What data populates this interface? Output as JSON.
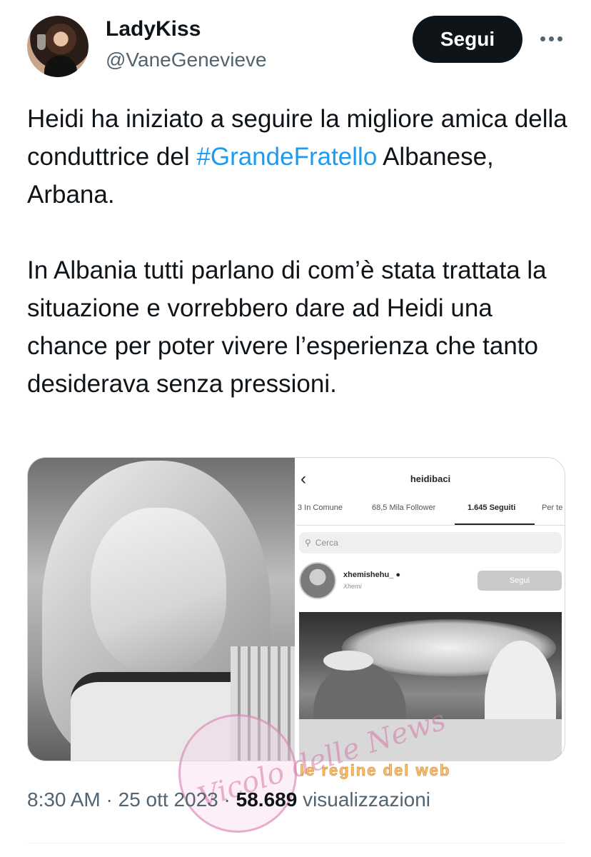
{
  "author": {
    "display_name": "LadyKiss",
    "handle": "@VaneGenevieve"
  },
  "actions": {
    "follow_label": "Segui"
  },
  "tweet": {
    "paragraph1_before": "Heidi ha iniziato a seguire la migliore amica della conduttrice del ",
    "hashtag": "#GrandeFratello",
    "paragraph1_after": " Albanese, Arbana.",
    "paragraph2": "In Albania tutti parlano di com’è stata trattata la situazione e vorrebbero dare ad Heidi una chance per poter vivere l’esperienza che tanto desiderava senza pressioni."
  },
  "embedded_instagram": {
    "username": "heidibaci",
    "tabs": [
      "3 In Comune",
      "68,5 Mila Follower",
      "1.645 Seguiti",
      "Per te"
    ],
    "active_tab": "1.645 Seguiti",
    "search_placeholder": "Cerca",
    "account": "xhemishehu_",
    "account_subtitle": "Xhemi",
    "follow_label": "Segui"
  },
  "meta": {
    "time": "8:30 AM",
    "separator": "·",
    "date": "25 ott 2023",
    "views_count": "58.689",
    "views_label": "visualizzazioni"
  },
  "watermarks": {
    "logo_text": "Vicolo delle News",
    "logo_small": "delle",
    "banner_text": "le regine del web"
  },
  "colors": {
    "text": "#0f1419",
    "secondary": "#536471",
    "link": "#1d9bf0",
    "follow_button": "#0f1419"
  }
}
